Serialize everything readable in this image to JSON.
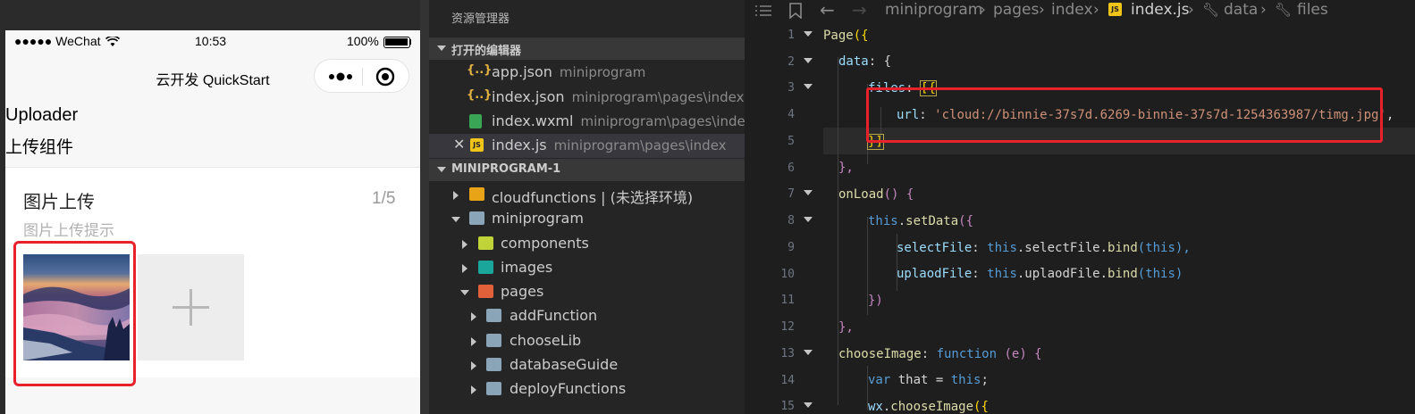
{
  "simulator": {
    "status": {
      "signal": "●●●●● WeChat",
      "time": "10:53",
      "battery": "100%"
    },
    "nav_title": "云开发 QuickStart",
    "title_en": "Uploader",
    "title_cn": "上传组件",
    "card": {
      "title": "图片上传",
      "count": "1/5",
      "tip": "图片上传提示"
    }
  },
  "explorer": {
    "title": "资源管理器",
    "open_editors_label": "打开的编辑器",
    "open_editors": [
      {
        "name": "app.json",
        "path": "miniprogram"
      },
      {
        "name": "index.json",
        "path": "miniprogram\\pages\\index"
      },
      {
        "name": "index.wxml",
        "path": "miniprogram\\pages\\index"
      },
      {
        "name": "index.js",
        "path": "miniprogram\\pages\\index"
      }
    ],
    "project_label": "MINIPROGRAM-1",
    "tree": [
      {
        "name": "cloudfunctions | (未选择环境)"
      },
      {
        "name": "miniprogram"
      },
      {
        "name": "components"
      },
      {
        "name": "images"
      },
      {
        "name": "pages"
      },
      {
        "name": "addFunction"
      },
      {
        "name": "chooseLib"
      },
      {
        "name": "databaseGuide"
      },
      {
        "name": "deployFunctions"
      }
    ]
  },
  "editor": {
    "breadcrumb": [
      "miniprogram",
      "pages",
      "index",
      "index.js",
      "data",
      "files"
    ],
    "line_numbers": [
      "1",
      "2",
      "3",
      "4",
      "5",
      "6",
      "7",
      "8",
      "9",
      "10",
      "11",
      "12",
      "13",
      "14",
      "15"
    ],
    "code": {
      "l1a": "Page",
      "l1b": "({",
      "l2a": "data",
      "l2b": ": {",
      "l3a": "files",
      "l3b": ": ",
      "l3c": "[{",
      "l4a": "url",
      "l4b": ": ",
      "l4c": "'cloud://binnie-37s7d.6269-binnie-37s7d-1254363987/timg.jpg'",
      "l4d": ",",
      "l5a": "}]",
      "l6a": "},",
      "l7a": "onLoad",
      "l7b": "() {",
      "l8a": "this",
      "l8b": ".",
      "l8c": "setData",
      "l8d": "({",
      "l9a": "selectFile",
      "l9b": ": ",
      "l9c": "this",
      "l9d": ".selectFile.",
      "l9e": "bind",
      "l9f": "(",
      "l9g": "this",
      "l9h": "),",
      "l10a": "uplaodFile",
      "l10b": ": ",
      "l10c": "this",
      "l10d": ".uplaodFile.",
      "l10e": "bind",
      "l10f": "(",
      "l10g": "this",
      "l10h": ")",
      "l11a": "})",
      "l12a": "},",
      "l13a": "chooseImage",
      "l13b": ": ",
      "l13c": "function",
      "l13d": " (",
      "l13e": "e",
      "l13f": ") {",
      "l14a": "var",
      "l14b": " that = ",
      "l14c": "this",
      "l14d": ";",
      "l15a": "wx",
      "l15b": ".",
      "l15c": "chooseImage",
      "l15d": "({"
    }
  },
  "colors": {
    "highlight": "#e8212b",
    "editor_bg": "#1e1e1e",
    "explorer_bg": "#252526"
  }
}
